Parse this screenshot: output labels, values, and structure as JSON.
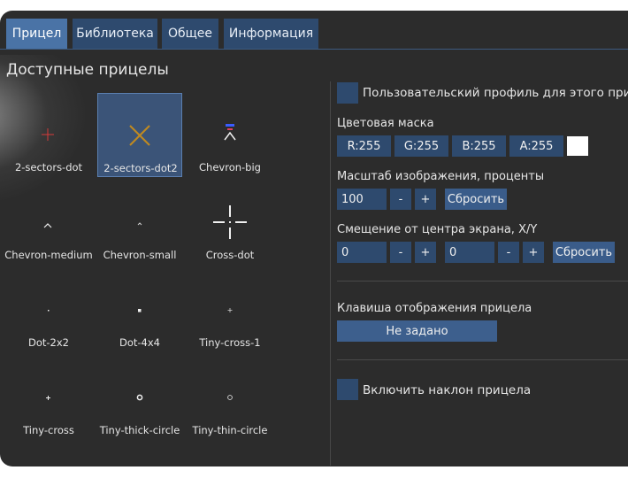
{
  "tabs": [
    {
      "label": "Прицел",
      "active": true
    },
    {
      "label": "Библиотека",
      "active": false
    },
    {
      "label": "Общее",
      "active": false
    },
    {
      "label": "Информация",
      "active": false
    }
  ],
  "library": {
    "title": "Доступные прицелы",
    "selected": "2-sectors-dot2",
    "items": [
      {
        "name": "2-sectors-dot",
        "icon": "red-cross-icon"
      },
      {
        "name": "2-sectors-dot2",
        "icon": "orange-x-icon"
      },
      {
        "name": "Chevron-big",
        "icon": "chevron-big-icon"
      },
      {
        "name": "Chevron-medium",
        "icon": "chevron-medium-icon"
      },
      {
        "name": "Chevron-small",
        "icon": "chevron-small-icon"
      },
      {
        "name": "Cross-dot",
        "icon": "cross-dot-icon"
      },
      {
        "name": "Dot-2x2",
        "icon": "dot-small-icon"
      },
      {
        "name": "Dot-4x4",
        "icon": "dot-large-icon"
      },
      {
        "name": "Tiny-cross-1",
        "icon": "tiny-cross-icon"
      },
      {
        "name": "Tiny-cross",
        "icon": "tiny-cross-dot-icon"
      },
      {
        "name": "Tiny-thick-circle",
        "icon": "thick-circle-icon"
      },
      {
        "name": "Tiny-thin-circle",
        "icon": "thin-circle-icon"
      }
    ]
  },
  "settings": {
    "custom_profile_label": "Пользовательский профиль для этого прицела",
    "color_mask_label": "Цветовая маска",
    "color": {
      "r": "R:255",
      "g": "G:255",
      "b": "B:255",
      "a": "A:255",
      "swatch": "#ffffff"
    },
    "scale_label": "Масштаб изображения, проценты",
    "scale_value": "100",
    "minus": "-",
    "plus": "+",
    "reset": "Сбросить",
    "offset_label": "Смещение от центра экрана, X/Y",
    "offset_x": "0",
    "offset_y": "0",
    "hotkey_label": "Клавиша отображения прицела",
    "hotkey_value": "Не задано",
    "tilt_label": "Включить наклон прицела"
  },
  "colors": {
    "accent": "#4a73a6",
    "panel": "#2e4a6e",
    "background": "#2c2c2c"
  }
}
